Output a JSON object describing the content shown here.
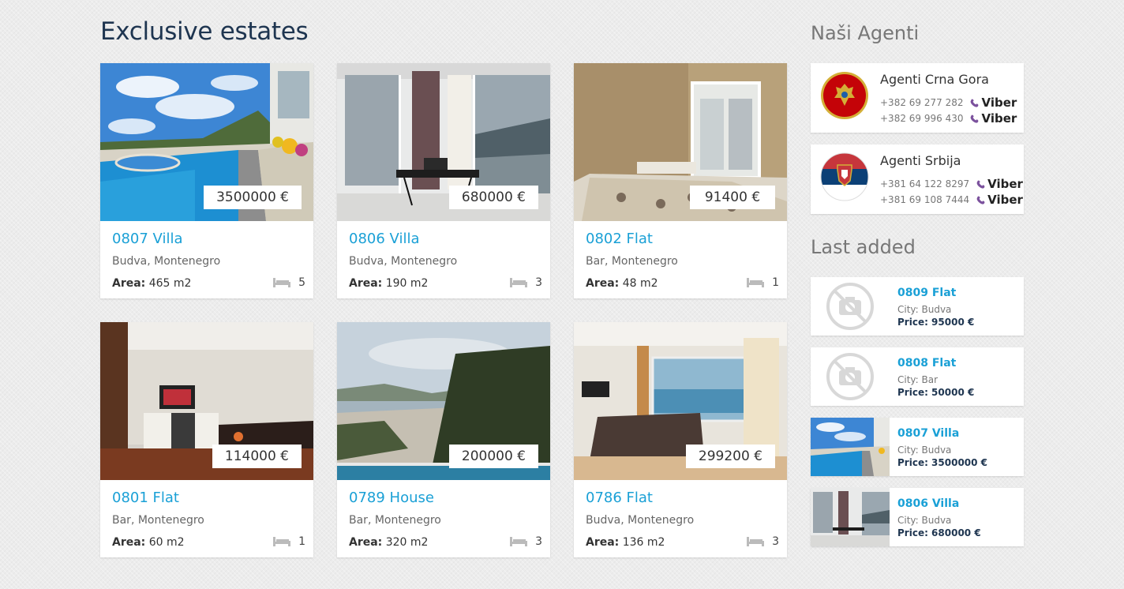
{
  "main_title": "Exclusive estates",
  "area_label": "Area:",
  "listings": [
    {
      "price": "3500000 €",
      "title": "0807 Villa",
      "location": "Budva, Montenegro",
      "area": "465 m2",
      "beds": "5"
    },
    {
      "price": "680000 €",
      "title": "0806 Villa",
      "location": "Budva, Montenegro",
      "area": "190 m2",
      "beds": "3"
    },
    {
      "price": "91400 €",
      "title": "0802 Flat",
      "location": "Bar, Montenegro",
      "area": "48 m2",
      "beds": "1"
    },
    {
      "price": "114000 €",
      "title": "0801 Flat",
      "location": "Bar, Montenegro",
      "area": "60 m2",
      "beds": "1"
    },
    {
      "price": "200000 €",
      "title": "0789 House",
      "location": "Bar, Montenegro",
      "area": "320 m2",
      "beds": "3"
    },
    {
      "price": "299200 €",
      "title": "0786 Flat",
      "location": "Budva, Montenegro",
      "area": "136 m2",
      "beds": "3"
    }
  ],
  "sidebar": {
    "agents_title": "Naši Agenti",
    "viber_label": "Viber",
    "agents": [
      {
        "name": "Agenti Crna Gora",
        "phones": [
          "+382 69 277 282",
          "+382 69 996 430"
        ],
        "flag": "montenegro-flag"
      },
      {
        "name": "Agenti Srbija",
        "phones": [
          "+381 64 122 8297",
          "+381 69 108 7444"
        ],
        "flag": "serbia-flag"
      }
    ],
    "last_title": "Last added",
    "last": [
      {
        "title": "0809 Flat",
        "city": "City: Budva",
        "price": "Price: 95000 €",
        "thumb": "no-photo"
      },
      {
        "title": "0808 Flat",
        "city": "City: Bar",
        "price": "Price: 50000 €",
        "thumb": "no-photo"
      },
      {
        "title": "0807 Villa",
        "city": "City: Budva",
        "price": "Price: 3500000 €",
        "thumb": "photo"
      },
      {
        "title": "0806 Villa",
        "city": "City: Budva",
        "price": "Price: 680000 €",
        "thumb": "photo"
      }
    ]
  },
  "colors": {
    "accent": "#1aa0d6",
    "title": "#1e3550",
    "viber": "#7b519d"
  }
}
